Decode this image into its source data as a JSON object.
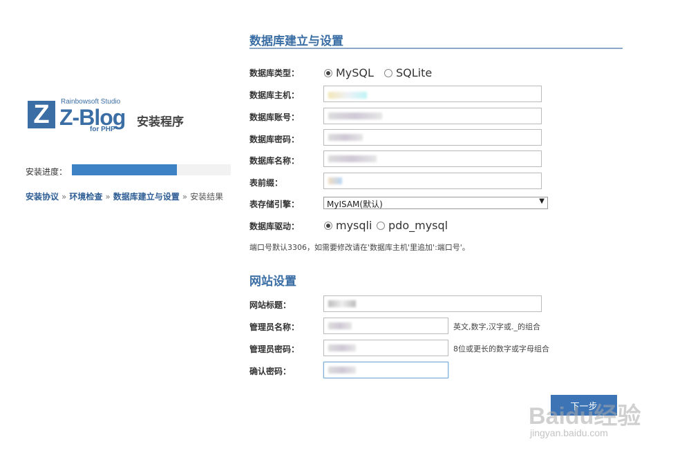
{
  "logo": {
    "studio": "Rainbowsoft Studio",
    "letter": "Z",
    "name": "Z-Blog",
    "platform": "for PHP",
    "setup": "安装程序"
  },
  "progress": {
    "label": "安装进度：",
    "percent": 66
  },
  "steps": [
    {
      "label": "安装协议",
      "done": true
    },
    {
      "label": "环境检查",
      "done": true
    },
    {
      "label": "数据库建立与设置",
      "done": true
    },
    {
      "label": "安装结果",
      "done": false
    }
  ],
  "step_separator": "»",
  "database_section": {
    "title": "数据库建立与设置",
    "type_label": "数据库类型：",
    "type_options": [
      "MySQL",
      "SQLite"
    ],
    "type_selected": "MySQL",
    "host_label": "数据库主机：",
    "user_label": "数据库账号：",
    "password_label": "数据库密码：",
    "name_label": "数据库名称：",
    "prefix_label": "表前缀：",
    "engine_label": "表存储引擎：",
    "engine_value": "MyISAM(默认)",
    "driver_label": "数据库驱动：",
    "driver_options": [
      "mysqli",
      "pdo_mysql"
    ],
    "driver_selected": "mysqli",
    "port_note": "端口号默认3306，如需要修改请在'数据库主机'里追加':端口号'。"
  },
  "site_section": {
    "title": "网站设置",
    "site_title_label": "网站标题：",
    "admin_name_label": "管理员名称：",
    "admin_name_hint": "英文,数字,汉字或._的组合",
    "admin_password_label": "管理员密码：",
    "admin_password_hint": "8位或更长的数字或字母组合",
    "confirm_password_label": "确认密码："
  },
  "next_button": "下一步",
  "watermark": {
    "main": "Baidu经验",
    "url": "jingyan.baidu.com"
  },
  "colors": {
    "accent": "#3a6ea5",
    "progress": "#3c82c5",
    "button": "#3c74b5"
  }
}
